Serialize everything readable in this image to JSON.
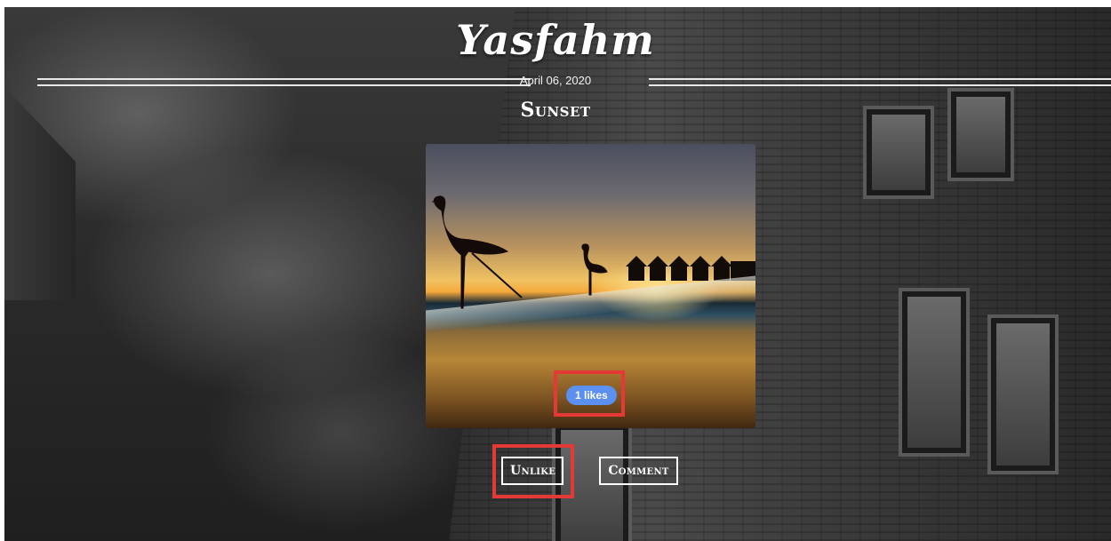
{
  "header": {
    "site_title": "Yasfahm",
    "date": "April 06, 2020",
    "post_title": "Sunset"
  },
  "photo": {
    "alt_subject": "flamingo-at-sunset-photo",
    "likes_label": "1 likes",
    "likes_count": 1
  },
  "actions": {
    "unlike_label": "Unlike",
    "comment_label": "Comment"
  },
  "colors": {
    "likes_badge": "#5b8ff0",
    "highlight": "#e53935",
    "text": "#ffffff"
  }
}
